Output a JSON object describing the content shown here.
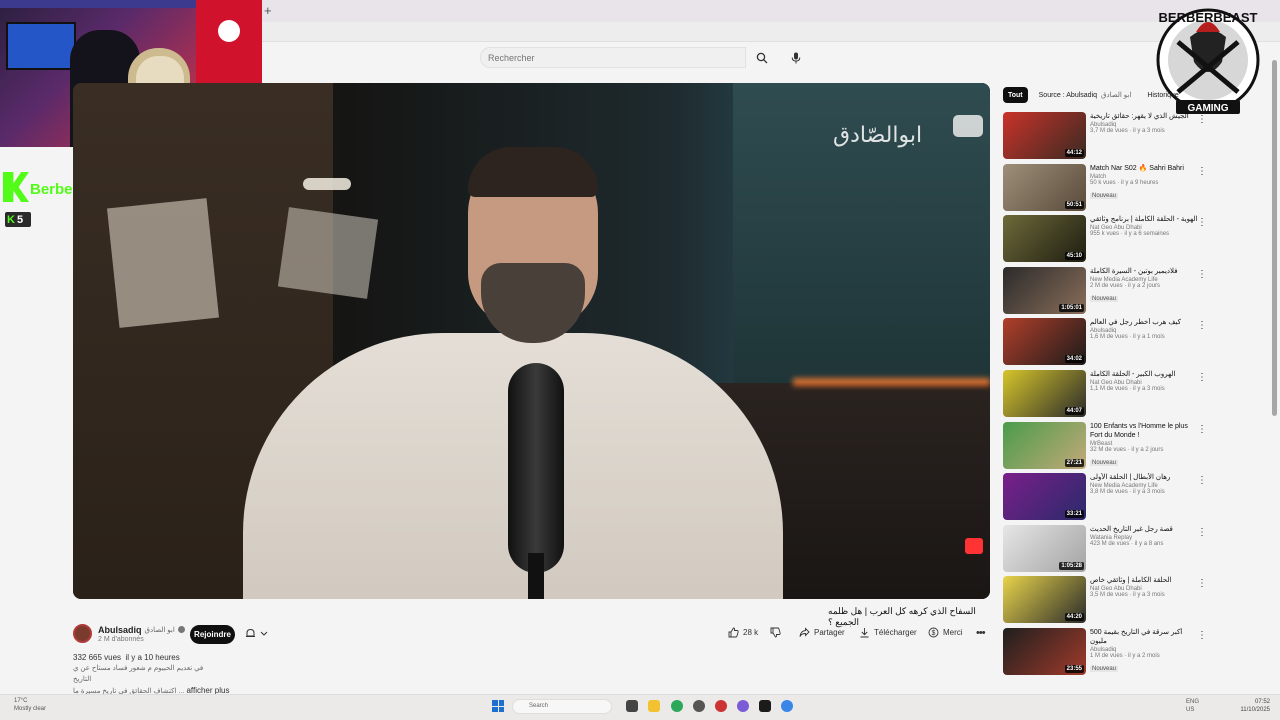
{
  "browser": {
    "new_tab": "+"
  },
  "search": {
    "placeholder": "Rechercher"
  },
  "stream_overlay": {
    "streamer_name": "BerberBeast",
    "viewer_count": "5",
    "brand_text_top": "BERBERBEAST",
    "brand_text_bottom": "GAMING"
  },
  "video": {
    "watermark": "ابوالصّادق",
    "title": "السفاح الذي كرهه كل العرب | هل ظلمه الجميع ؟",
    "channel": "Abulsadiq",
    "channel_ar": "ابو الصادق",
    "subscribers": "2 M d'abonnés",
    "join_label": "Rejoindre",
    "likes": "28 k",
    "share_label": "Partager",
    "download_label": "Télécharger",
    "thanks_label": "Merci",
    "views": "332 665 vues",
    "posted": "il y a 10 heures",
    "desc_line1": "في تعديم الحبيوم م شعور فساد مستاح عن ي",
    "desc_line2": "التاريخ",
    "desc_line3": "اكتشاف الحقائق في تاريخ مسيرة ما ...",
    "show_more": "afficher plus"
  },
  "chips": [
    "Tout",
    "Source : Abulsadiq",
    "ابو الصادق",
    "Historique"
  ],
  "recommendations": [
    {
      "title": "الجيش الذي لا يقهر: حقائق تاريخية",
      "channel": "Abulsadiq",
      "meta": "3,7 M de vues · il y a 3 mois",
      "duration": "44:12",
      "badge": ""
    },
    {
      "title": "Match Nar S02 🔥 Sahri Bahri",
      "channel": "Match",
      "meta": "50 k vues · il y a 9 heures",
      "duration": "50:51",
      "badge": "Nouveau"
    },
    {
      "title": "الهوية - الحلقة الكاملة | برنامج وثائقي",
      "channel": "Nat Geo Abu Dhabi",
      "meta": "955 k vues · il y a 6 semaines",
      "duration": "45:10",
      "badge": ""
    },
    {
      "title": "فلاديمير بوتين - السيرة الكاملة",
      "channel": "New Media Academy Life",
      "meta": "2 M de vues · il y a 2 jours",
      "duration": "1:05:01",
      "badge": "Nouveau"
    },
    {
      "title": "كيف هرب أخطر رجل في العالم",
      "channel": "Abulsadiq",
      "meta": "1,6 M de vues · il y a 1 mois",
      "duration": "34:02",
      "badge": ""
    },
    {
      "title": "الهروب الكبير - الحلقة الكاملة",
      "channel": "Nat Geo Abu Dhabi",
      "meta": "1,1 M de vues · il y a 3 mois",
      "duration": "44:07",
      "badge": ""
    },
    {
      "title": "100 Enfants vs l'Homme le plus Fort du Monde !",
      "channel": "MrBeast",
      "meta": "32 M de vues · il y a 2 jours",
      "duration": "27:21",
      "badge": "Nouveau"
    },
    {
      "title": "رهان الأبطال | الحلقة الأولى",
      "channel": "New Media Academy Life",
      "meta": "3,8 M de vues · il y a 3 mois",
      "duration": "33:21",
      "badge": ""
    },
    {
      "title": "قصة رجل غير التاريخ الحديث",
      "channel": "Watania Replay",
      "meta": "423 M de vues · il y a 8 ans",
      "duration": "1:05:28",
      "badge": ""
    },
    {
      "title": "الحلقة الكاملة | وثائقي خاص",
      "channel": "Nat Geo Abu Dhabi",
      "meta": "3,5 M de vues · il y a 3 mois",
      "duration": "44:20",
      "badge": ""
    },
    {
      "title": "أكبر سرقة في التاريخ بقيمة 500 مليون",
      "channel": "Abulsadiq",
      "meta": "1 M de vues · il y a 2 mois",
      "duration": "23:55",
      "badge": "Nouveau"
    }
  ],
  "taskbar": {
    "weather_temp": "17°C",
    "weather_desc": "Mostly clear",
    "search_label": "Search",
    "lang": "ENG",
    "lang_sub": "US",
    "time": "07:52",
    "date": "11/10/2025"
  },
  "colors": {
    "kick_green": "#53fc18",
    "yt_red": "#ff0000",
    "join_bg": "#0f0f0f"
  }
}
